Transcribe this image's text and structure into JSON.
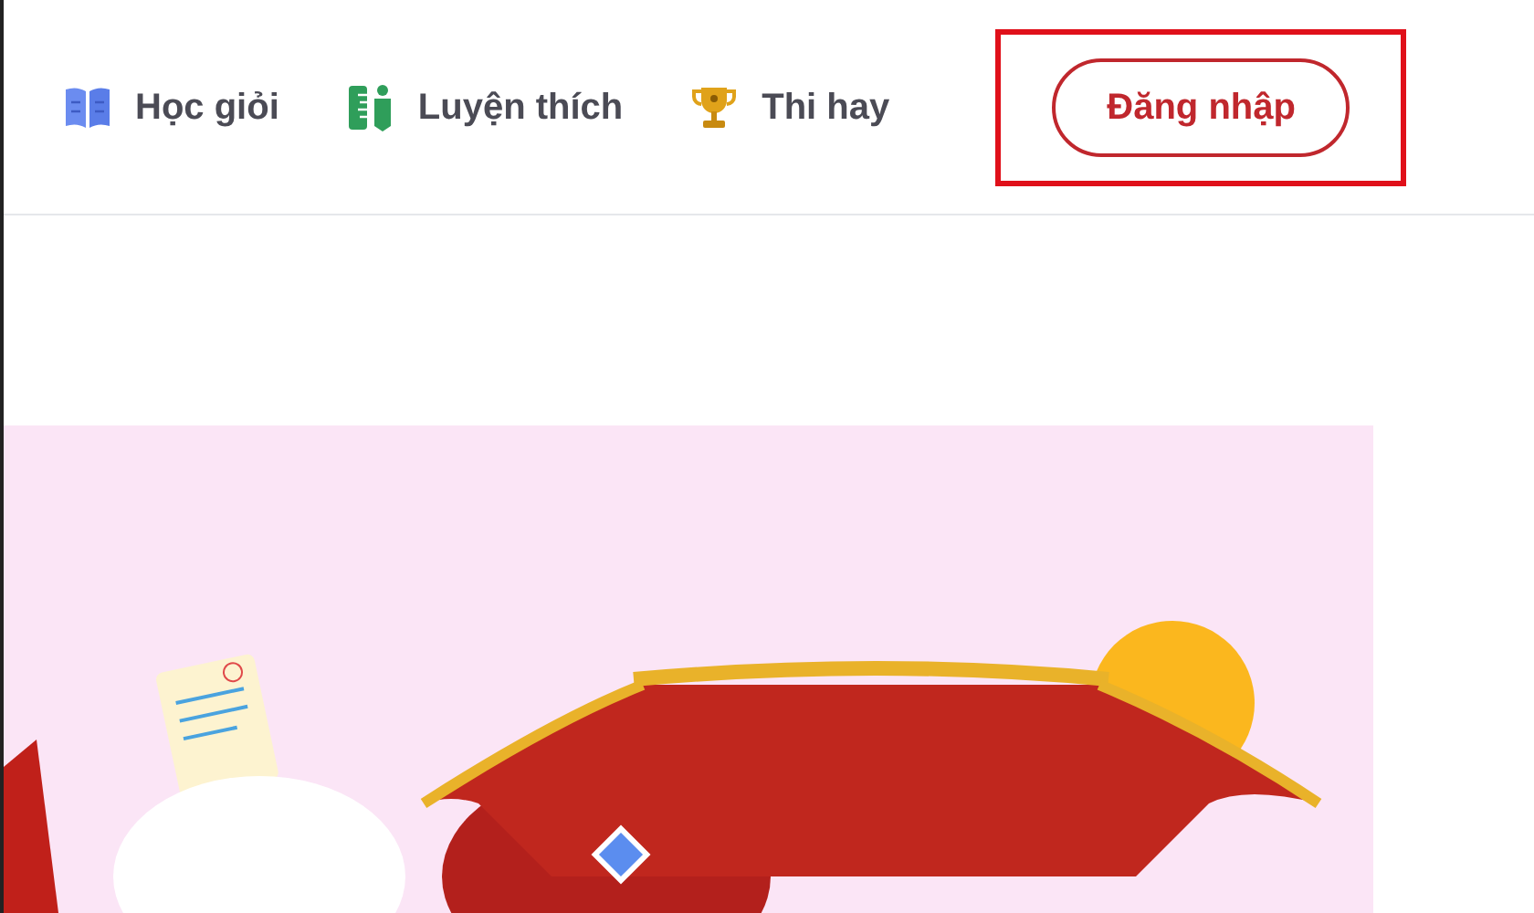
{
  "nav": {
    "items": [
      {
        "kind": "book",
        "label": "Học giỏi"
      },
      {
        "kind": "pencil",
        "label": "Luyện thích"
      },
      {
        "kind": "trophy",
        "label": "Thi hay"
      }
    ],
    "login_button": {
      "label": "Đăng nhập",
      "highlighted": true
    }
  }
}
